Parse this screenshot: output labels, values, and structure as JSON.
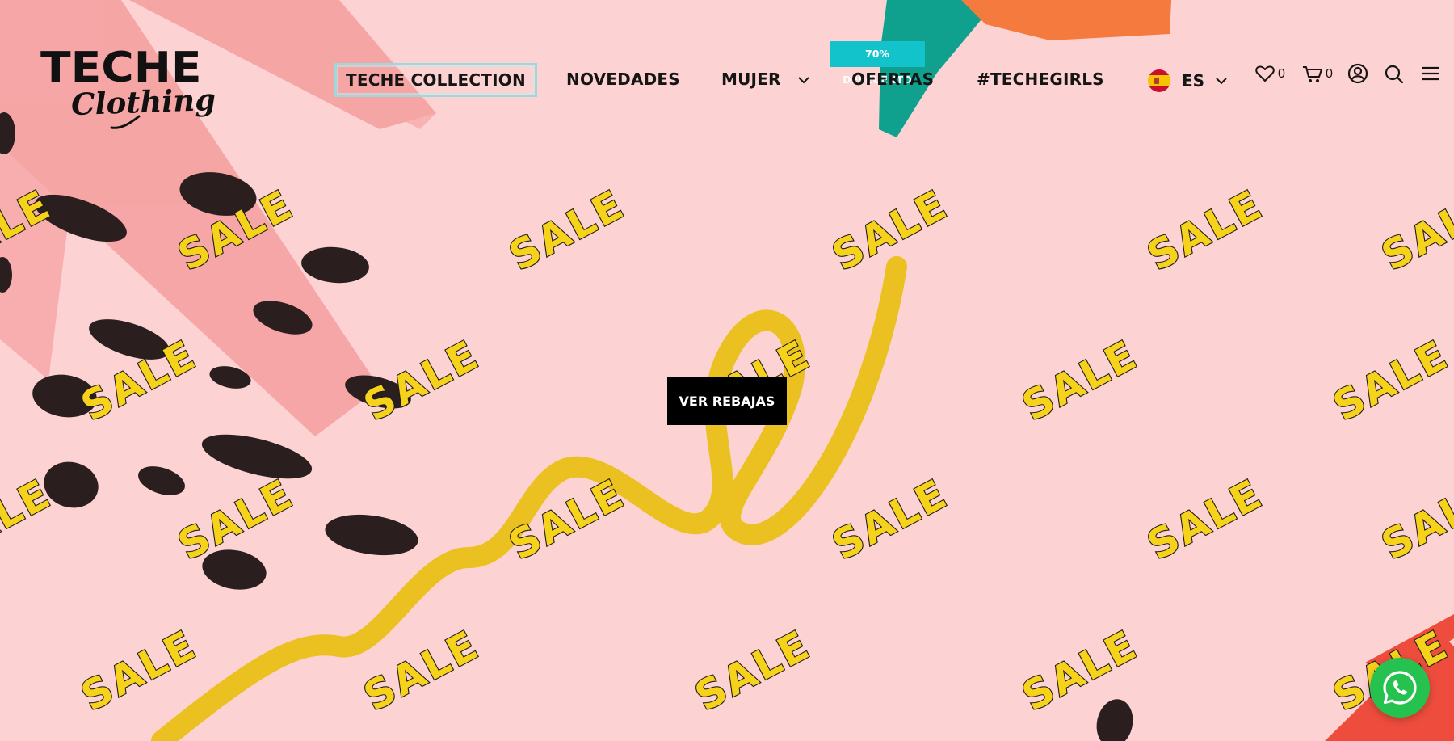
{
  "brand": {
    "name": "TECHE",
    "tagline": "Clothing"
  },
  "nav": {
    "collection": "TECHE COLLECTION",
    "novedades": "NOVEDADES",
    "mujer": "MUJER",
    "ofertas": "OFERTAS",
    "ofertas_badge": "70% DESCUENTO",
    "techegirls": "#TECHEGIRLS"
  },
  "language": {
    "code": "ES",
    "flag": "spain-flag"
  },
  "header_icons": {
    "wishlist_icon": "heart-icon",
    "wishlist_count": "0",
    "cart_icon": "cart-icon",
    "cart_count": "0",
    "account_icon": "user-icon",
    "search_icon": "search-icon",
    "menu_icon": "menu-icon"
  },
  "hero": {
    "background_word": "SALE",
    "cta_label": "VER REBAJAS"
  },
  "chat": {
    "icon": "whatsapp-icon"
  },
  "colors": {
    "background": "#fdd2d2",
    "brand_accent": "#12c3cc",
    "sale_text": "#f7d21a",
    "whatsapp": "#25c24f"
  }
}
